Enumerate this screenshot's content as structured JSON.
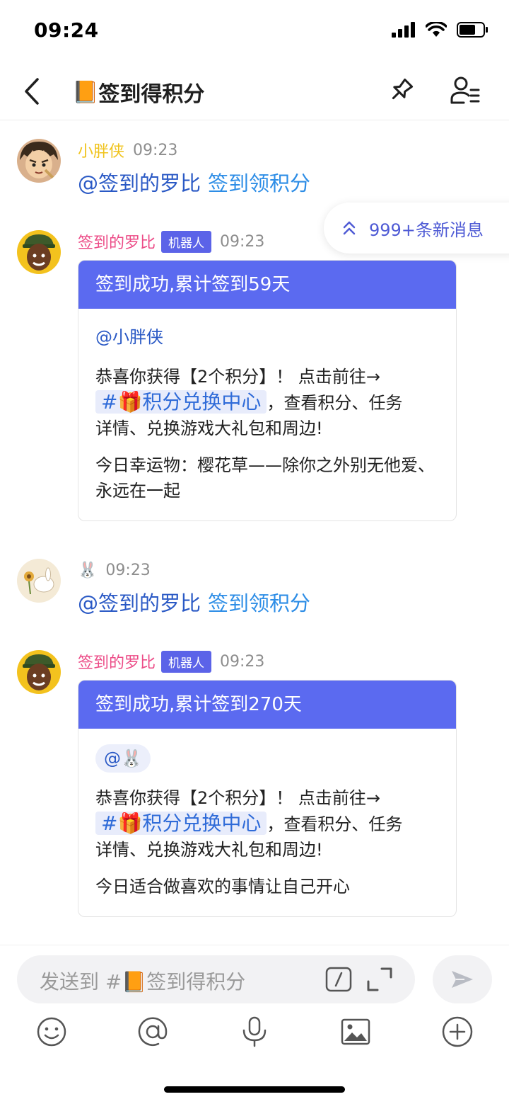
{
  "status_bar": {
    "time": "09:24"
  },
  "nav": {
    "channel_emoji": "📙",
    "title": "签到得积分"
  },
  "new_messages_pill": {
    "label": "999+条新消息"
  },
  "messages": [
    {
      "sender": "小胖侠",
      "time": "09:23",
      "mention": "@签到的罗比",
      "command": "签到领积分"
    },
    {
      "sender": "签到的罗比",
      "badge": "机器人",
      "time": "09:23",
      "card": {
        "header": "签到成功,累计签到59天",
        "at": "@小胖侠",
        "para1_a": "恭喜你获得【2个积分】！ 点击前往→",
        "channel_chip": "#🎁积分兑换中心",
        "para1_b": "，查看积分、任务",
        "para1_c": "详情、兑换游戏大礼包和周边!",
        "para2": "今日幸运物：樱花草——除你之外别无他爱、永远在一起"
      }
    },
    {
      "sender": "🐰",
      "time": "09:23",
      "mention": "@签到的罗比",
      "command": "签到领积分"
    },
    {
      "sender": "签到的罗比",
      "badge": "机器人",
      "time": "09:23",
      "card": {
        "header": "签到成功,累计签到270天",
        "at": "@🐰",
        "para1_a": "恭喜你获得【2个积分】！ 点击前往→",
        "channel_chip": "#🎁积分兑换中心",
        "para1_b": "，查看积分、任务",
        "para1_c": "详情、兑换游戏大礼包和周边!",
        "para2": "今日适合做喜欢的事情让自己开心"
      }
    }
  ],
  "composer": {
    "placeholder": "发送到 #📙签到得积分"
  },
  "colors": {
    "accent": "#5b6af0",
    "mention": "#2a59c5",
    "command": "#2d8de6",
    "bot_name": "#ec4b87",
    "user_name": "#f0c31c"
  }
}
